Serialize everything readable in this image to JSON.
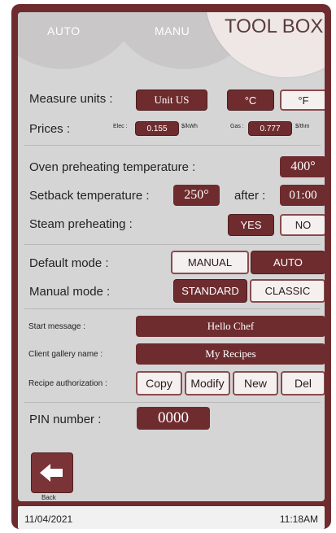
{
  "tabs": {
    "auto": "AUTO",
    "manu": "MANU",
    "toolbox": "TOOL BOX"
  },
  "measure": {
    "label": "Measure units :",
    "unit": "Unit US",
    "celsius": "°C",
    "fahrenheit": "°F"
  },
  "prices": {
    "label": "Prices :",
    "elec_label": "Elec :",
    "elec_value": "0.155",
    "elec_unit": "$/kWh",
    "gas_label": "Gas :",
    "gas_value": "0.777",
    "gas_unit": "$/thm"
  },
  "oven_preheat": {
    "label": "Oven preheating temperature :",
    "value": "400°"
  },
  "setback": {
    "label": "Setback temperature :",
    "value": "250°",
    "after_label": "after :",
    "after_value": "01:00"
  },
  "steam": {
    "label": "Steam preheating :",
    "yes": "YES",
    "no": "NO"
  },
  "default_mode": {
    "label": "Default mode :",
    "manual": "MANUAL",
    "auto": "AUTO"
  },
  "manual_mode": {
    "label": "Manual mode :",
    "standard": "STANDARD",
    "classic": "CLASSIC"
  },
  "start_message": {
    "label": "Start message :",
    "value": "Hello Chef"
  },
  "gallery": {
    "label": "Client gallery name :",
    "value": "My Recipes"
  },
  "recipe_auth": {
    "label": "Recipe authorization :",
    "copy": "Copy",
    "modify": "Modify",
    "new": "New",
    "del": "Del"
  },
  "pin": {
    "label": "PIN number :",
    "value": "0000"
  },
  "back": {
    "label": "Back"
  },
  "status": {
    "date": "11/04/2021",
    "time": "11:18AM"
  },
  "colors": {
    "accent": "#6e2c2f",
    "panel": "#d6d5d6",
    "highlight": "#f4f0ef"
  }
}
